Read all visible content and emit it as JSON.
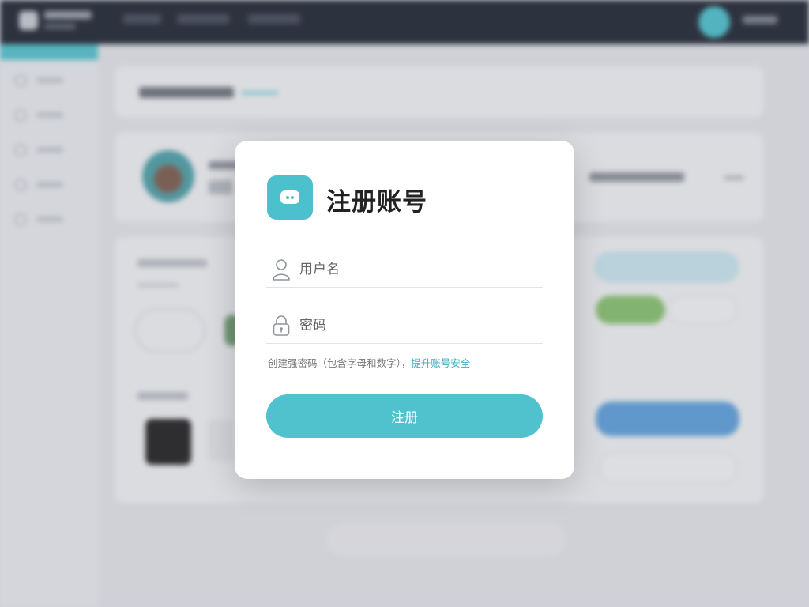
{
  "background": {
    "topbar": {
      "brand_name": "",
      "nav_items": [
        "",
        "",
        ""
      ],
      "user_name": ""
    },
    "sidebar": {
      "items": [
        "",
        "",
        "",
        "",
        ""
      ]
    },
    "header": {
      "title": ""
    }
  },
  "modal": {
    "title": "注册账号",
    "icon": "chat-bubble-icon",
    "username_placeholder": "用户名",
    "username_icon": "user-icon",
    "password_placeholder": "密码",
    "password_icon": "lock-icon",
    "password_hint": "创建强密码（包含字母和数字），",
    "password_hint_link": "提升账号安全",
    "submit_label": "注册"
  },
  "colors": {
    "accent": "#4fc2ce",
    "topbar": "#1d2330",
    "link": "#3cafc2"
  }
}
